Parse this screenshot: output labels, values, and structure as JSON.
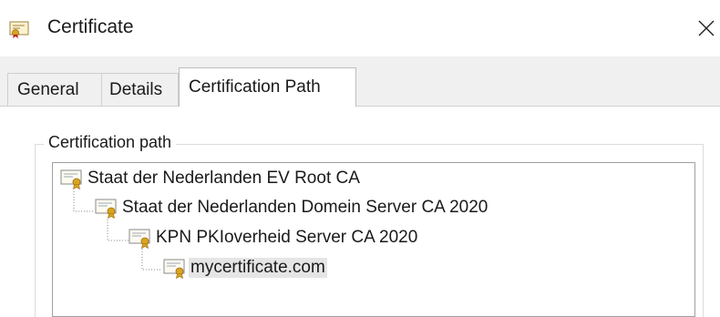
{
  "window": {
    "title": "Certificate",
    "icon": "certificate-icon",
    "close_icon": "close-icon"
  },
  "tabs": [
    {
      "label": "General",
      "active": false
    },
    {
      "label": "Details",
      "active": false
    },
    {
      "label": "Certification Path",
      "active": true
    }
  ],
  "certification_path": {
    "group_label": "Certification path",
    "items": [
      {
        "label": "Staat der Nederlanden EV Root CA",
        "level": 0,
        "icon": "certificate-icon",
        "selected": false
      },
      {
        "label": "Staat der Nederlanden Domein Server CA 2020",
        "level": 1,
        "icon": "certificate-icon",
        "selected": false
      },
      {
        "label": "KPN PKIoverheid Server CA 2020",
        "level": 2,
        "icon": "certificate-icon",
        "selected": false
      },
      {
        "label": "mycertificate.com",
        "level": 3,
        "icon": "certificate-icon",
        "selected": true
      }
    ]
  },
  "colors": {
    "certificate_seal": "#d9a520",
    "tab_background": "#f0f0f0",
    "selection_background": "#e5e5e5"
  }
}
